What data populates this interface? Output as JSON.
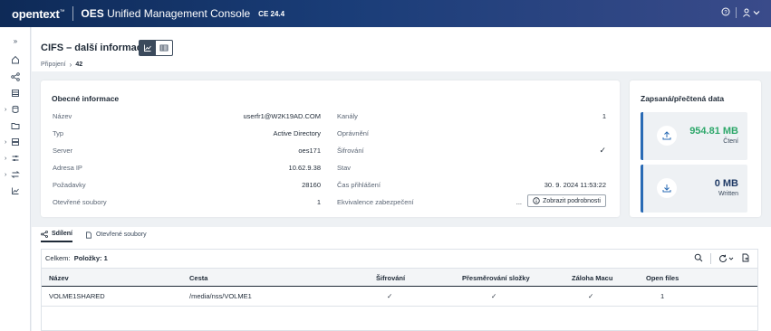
{
  "header": {
    "brand": "opentext",
    "brand_tm": "™",
    "app_title_strong": "OES",
    "app_title_rest": " Unified Management Console",
    "version": "CE 24.4"
  },
  "page": {
    "title": "CIFS – další informace",
    "breadcrumb_parent": "Připojení",
    "breadcrumb_current": "42"
  },
  "general": {
    "title": "Obecné informace",
    "left": [
      {
        "label": "Název",
        "value": "userfr1@W2K19AD.COM"
      },
      {
        "label": "Typ",
        "value": "Active Directory"
      },
      {
        "label": "Server",
        "value": "oes171"
      },
      {
        "label": "Adresa IP",
        "value": "10.62.9.38"
      },
      {
        "label": "Požadavky",
        "value": "28160"
      },
      {
        "label": "Otevřené soubory",
        "value": "1"
      }
    ],
    "right": [
      {
        "label": "Kanály",
        "value": "1"
      },
      {
        "label": "Oprávnění",
        "value": ""
      },
      {
        "label": "Šifrování",
        "value": "✓"
      },
      {
        "label": "Stav",
        "value": ""
      },
      {
        "label": "Čas přihlášení",
        "value": "30. 9. 2024 11:53:22"
      },
      {
        "label": "Ekvivalence zabezpečení",
        "value": "..."
      }
    ],
    "details_button": "Zobrazit podrobnosti"
  },
  "data_panel": {
    "title": "Zapsaná/přečtená data",
    "read_value": "954.81 MB",
    "read_label": "Čtení",
    "written_value": "0 MB",
    "written_label": "Written"
  },
  "tabs": [
    {
      "label": "Sdílení",
      "icon": "share-icon"
    },
    {
      "label": "Otevřené soubory",
      "icon": "file-icon"
    }
  ],
  "table": {
    "summary_prefix": "Celkem:",
    "summary_value": "Položky: 1",
    "columns": [
      "Název",
      "Cesta",
      "Šifrování",
      "Přesměrování složky",
      "Záloha Macu",
      "Open files"
    ],
    "rows": [
      [
        "VOLME1SHARED",
        "/media/nss/VOLME1",
        "✓",
        "✓",
        "✓",
        "1"
      ]
    ]
  },
  "colors": {
    "accent_green": "#2fa86b",
    "accent_blue": "#2a6bb5",
    "header_dark": "#0e2a57"
  }
}
